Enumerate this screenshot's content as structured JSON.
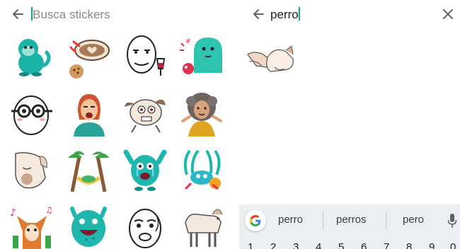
{
  "left": {
    "search": {
      "placeholder": "Busca stickers"
    },
    "stickers": [
      {
        "name": "monkey"
      },
      {
        "name": "coffee-cookie"
      },
      {
        "name": "meme-face-wine"
      },
      {
        "name": "teal-monster"
      },
      {
        "name": "glasses-face"
      },
      {
        "name": "yawning-woman"
      },
      {
        "name": "surprised-dog"
      },
      {
        "name": "curly-hair-woman"
      },
      {
        "name": "dog-bowing"
      },
      {
        "name": "chameleon-hammock"
      },
      {
        "name": "teal-monster-crying"
      },
      {
        "name": "sea-creature"
      },
      {
        "name": "music-fox"
      },
      {
        "name": "teal-monster-laughing"
      },
      {
        "name": "meme-face-2"
      },
      {
        "name": "dog-standing"
      }
    ]
  },
  "right": {
    "search": {
      "query": "perro"
    },
    "results": [
      {
        "name": "dog-hand-paw"
      }
    ],
    "keyboard": {
      "suggestions": [
        "perro",
        "perros",
        "pero"
      ],
      "digits": [
        "1",
        "2",
        "3",
        "4",
        "5",
        "6",
        "7",
        "8",
        "9",
        "0"
      ],
      "google_color_blue": "#4285F4"
    }
  }
}
